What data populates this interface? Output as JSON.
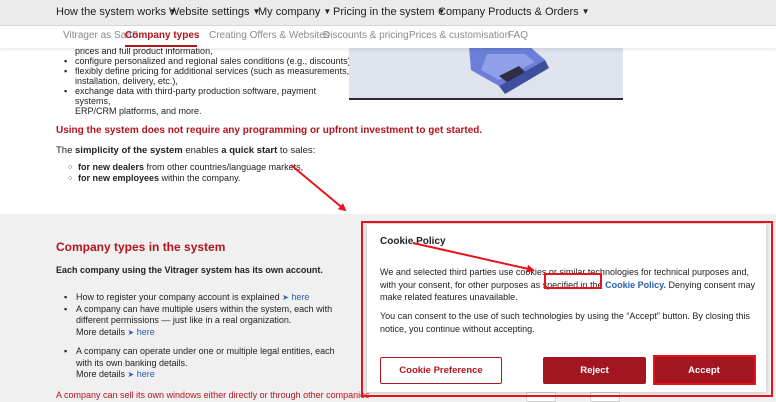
{
  "top_nav": [
    {
      "label": "How the system works",
      "icon": "chevron-down-icon"
    },
    {
      "label": "Website settings",
      "icon": "chevron-down-icon"
    },
    {
      "label": "My company",
      "icon": "chevron-down-icon"
    },
    {
      "label": "Pricing in the system",
      "icon": "chevron-down-icon"
    },
    {
      "label": "Company Products & Orders",
      "icon": "chevron-down-icon"
    }
  ],
  "sub_nav": [
    {
      "label": "Vitrager as SaaS",
      "active": false
    },
    {
      "label": "Company types",
      "active": true
    },
    {
      "label": "Creating Offers & Websites",
      "active": false
    },
    {
      "label": "Discounts & pricing",
      "active": false
    },
    {
      "label": "Prices & customisation",
      "active": false
    },
    {
      "label": "FAQ",
      "active": false
    }
  ],
  "intro_list": [
    "prices and full product information,",
    "configure personalized and regional sales conditions (e.g., discounts),",
    "flexibly define pricing for additional services (such as measurements,",
    "installation, delivery, etc.),",
    "exchange data with third-party production software, payment systems,",
    "ERP/CRM platforms, and more."
  ],
  "no_programming_text": "Using the system does not require any programming or upfront investment to get started.",
  "simplicity": {
    "prefix": "The ",
    "bold1": "simplicity of the system",
    "middle": " enables ",
    "bold2": "a quick start",
    "suffix": " to sales:"
  },
  "simplicity_items": [
    {
      "bold": "for new dealers",
      "rest": " from other countries/language markets,"
    },
    {
      "bold": "for new employees",
      "rest": " within the company."
    }
  ],
  "company_types": {
    "title": "Company types in the system",
    "subtitle": "Each company using the Vitrager system has its own account.",
    "items": {
      "register_text": "How to register your company account is explained ",
      "register_link": "here",
      "users_text": "A company can have multiple users within the system, each with different permissions — just like in a real organization.",
      "users_more": "More details ",
      "users_link": "here",
      "entities_text": "A company can operate under one or multiple legal entities, each with its own banking details.",
      "entities_more": "More details ",
      "entities_link": "here"
    },
    "bottom_text": "A company can sell its own windows either directly or through other companies"
  },
  "arrow_glyph": "➤",
  "cookie": {
    "title": "Cookie Policy",
    "text1_before": "We and selected third parties use cookies or similar technologies for technical purposes and, with your consent, for other purposes as specified in the ",
    "policy_link": "Cookie Policy.",
    "text1_after": " Denying consent may make related features unavailable.",
    "text2": "You can consent to the use of such technologies by using the “Accept” button. By closing this notice, you continue without accepting.",
    "btn_preference": "Cookie Preference",
    "btn_reject": "Reject",
    "btn_accept": "Accept"
  },
  "colors": {
    "brand_red": "#b3151f",
    "button_red": "#a31621",
    "annotation_red": "#e8131a",
    "link_blue": "#2a5db0"
  }
}
